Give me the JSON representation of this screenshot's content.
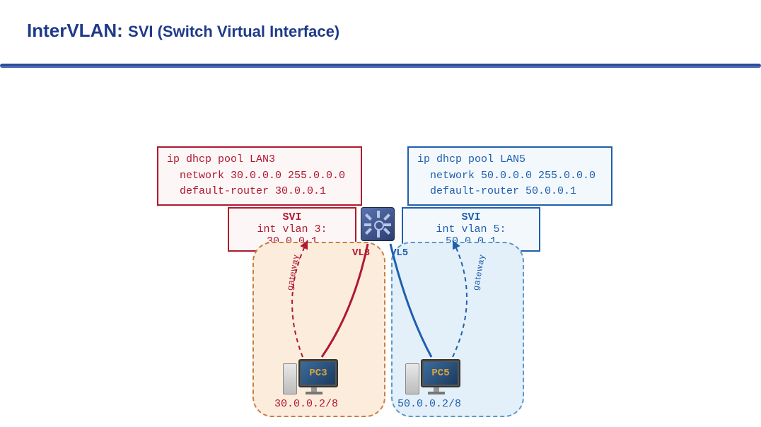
{
  "title": {
    "main": "InterVLAN:",
    "sub": "SVI (Switch Virtual Interface)"
  },
  "dhcp": {
    "lan3": {
      "line1": "ip dhcp pool LAN3",
      "line2": "network 30.0.0.0 255.0.0.0",
      "line3": "default-router 30.0.0.1"
    },
    "lan5": {
      "line1": "ip dhcp pool LAN5",
      "line2": "network 50.0.0.0 255.0.0.0",
      "line3": "default-router 50.0.0.1"
    }
  },
  "svi": {
    "vlan3": {
      "title": "SVI",
      "cmd": "int vlan 3: 30.0.0.1"
    },
    "vlan5": {
      "title": "SVI",
      "cmd": "int vlan 5: 50.0.0.1"
    }
  },
  "links": {
    "vl3": "VL3",
    "vl5": "VL5",
    "gateway_red": "gateway",
    "gateway_blue": "gateway"
  },
  "pcs": {
    "pc3": {
      "name": "PC3",
      "ip": "30.0.0.2/8"
    },
    "pc5": {
      "name": "PC5",
      "ip": "50.0.0.2/8"
    }
  },
  "icons": {
    "l3switch": "layer3-switch-icon",
    "cursor": "cursor-icon"
  }
}
